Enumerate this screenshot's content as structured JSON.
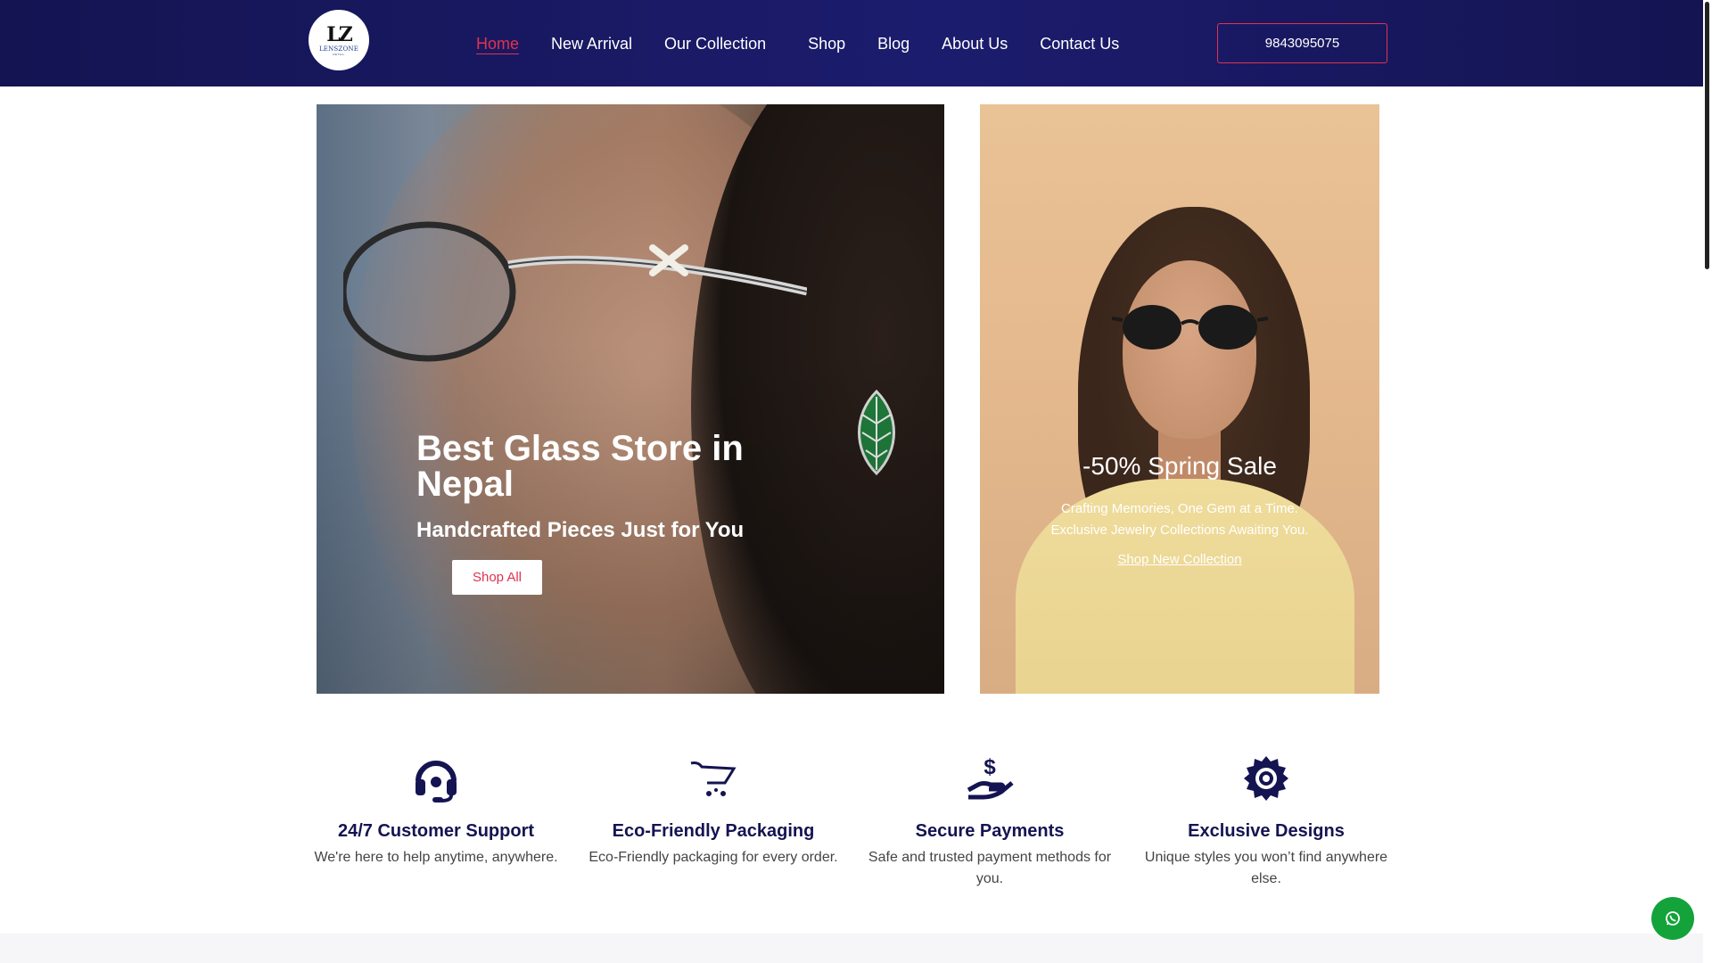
{
  "brand": {
    "logo_mark": "LZ",
    "logo_word": "LENSZONE",
    "logo_sub": "RETAIL"
  },
  "nav": {
    "items": [
      {
        "label": "Home",
        "active": true
      },
      {
        "label": "New Arrival"
      },
      {
        "label": "Our Collection"
      },
      {
        "label": "Shop"
      },
      {
        "label": "Blog"
      },
      {
        "label": "About Us"
      },
      {
        "label": "Contact Us"
      }
    ],
    "phone": "9843095075"
  },
  "hero_left": {
    "title": "Best Glass Store in Nepal",
    "subtitle": "Handcrafted Pieces Just for You",
    "button": "Shop All"
  },
  "hero_right": {
    "title": "-50% Spring Sale",
    "line1": "Crafting Memories, One Gem at a Time.",
    "line2": "Exclusive Jewelry Collections Awaiting You.",
    "link": "Shop New Collection"
  },
  "features": [
    {
      "icon": "headset-icon",
      "title": "24/7 Customer Support",
      "text": "We're here to help anytime, anywhere."
    },
    {
      "icon": "cart-icon",
      "title": "Eco-Friendly Packaging",
      "text": "Eco-Friendly packaging for every order."
    },
    {
      "icon": "hand-dollar-icon",
      "title": "Secure Payments",
      "text": "Safe and trusted payment methods for you."
    },
    {
      "icon": "gear-icon",
      "title": "Exclusive Designs",
      "text": "Unique styles you won’t find anywhere else."
    }
  ],
  "colors": {
    "header": "#1c1c6e",
    "accent": "#e0334f",
    "feature_title": "#141452",
    "whatsapp": "#13a33a"
  },
  "floating": {
    "icon": "whatsapp-icon"
  }
}
